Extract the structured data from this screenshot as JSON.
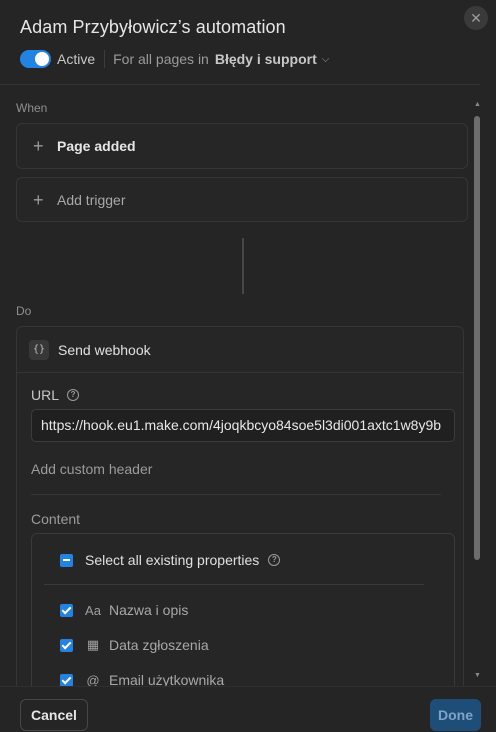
{
  "dialog": {
    "title": "Adam Przybyłowicz’s automation",
    "close_icon": "close-icon"
  },
  "status": {
    "toggle_on": true,
    "active_label": "Active",
    "scope_label": "For all pages in",
    "scope_value": "Błędy i support"
  },
  "when": {
    "label": "When",
    "trigger": "Page added",
    "add_trigger": "Add trigger"
  },
  "do": {
    "label": "Do",
    "action_icon": "braces-icon",
    "action_title": "Send webhook",
    "url_label": "URL",
    "url_value": "https://hook.eu1.make.com/4joqkbcyo84soe5l3di001axtc1w8y9b",
    "add_custom_header": "Add custom header",
    "content_label": "Content",
    "select_all_label": "Select all existing properties",
    "properties": [
      {
        "icon": "text-icon",
        "glyph": "Aa",
        "name": "Nazwa i opis",
        "checked": true
      },
      {
        "icon": "calendar-icon",
        "glyph": "▦",
        "name": "Data zgłoszenia",
        "checked": true
      },
      {
        "icon": "at-icon",
        "glyph": "@",
        "name": "Email użytkownika",
        "checked": true
      }
    ]
  },
  "footer": {
    "cancel_label": "Cancel",
    "done_label": "Done"
  },
  "colors": {
    "accent": "#2383e2",
    "background": "#252525",
    "done_disabled": "#1e4e78"
  }
}
